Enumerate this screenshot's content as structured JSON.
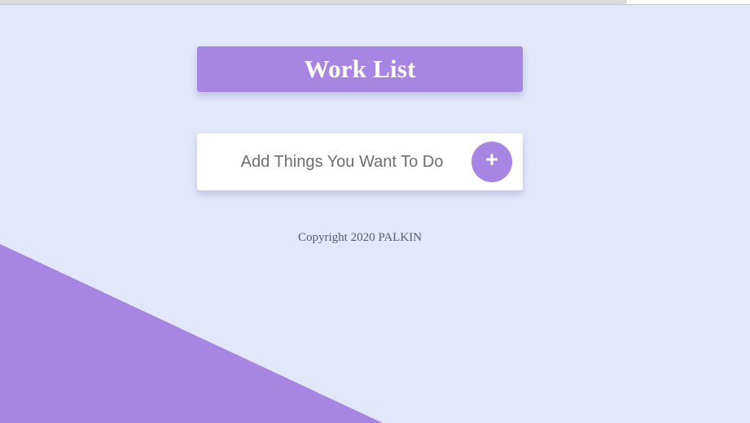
{
  "app": {
    "title": "Work List"
  },
  "task_input": {
    "placeholder": "Add Things You Want To Do",
    "value": ""
  },
  "add_button": {
    "label": "+",
    "icon": "plus-icon"
  },
  "footer": {
    "copyright": "Copyright 2020 PALKIN"
  },
  "colors": {
    "background": "#e3e7fb",
    "accent": "#a785e2",
    "card": "#ffffff",
    "text_muted": "#6e6e6e"
  }
}
